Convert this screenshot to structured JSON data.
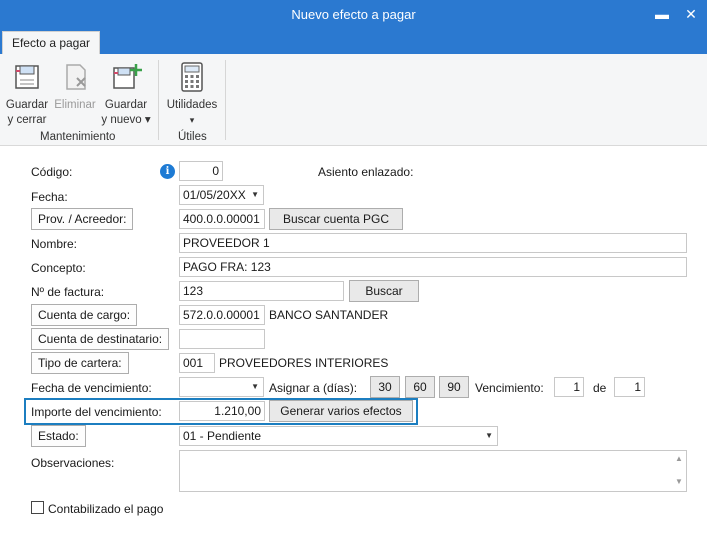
{
  "window": {
    "title": "Nuevo efecto a pagar"
  },
  "tabs": [
    {
      "label": "Efecto a pagar"
    }
  ],
  "ribbon": {
    "guardar_cerrar": {
      "line1": "Guardar",
      "line2": "y cerrar"
    },
    "eliminar": {
      "label": "Eliminar"
    },
    "guardar_nuevo": {
      "line1": "Guardar",
      "line2": "y nuevo ▾"
    },
    "utilidades": {
      "label": "Utilidades",
      "arrow": "▾"
    },
    "group_mantenimiento": "Mantenimiento",
    "group_utiles": "Útiles"
  },
  "form": {
    "codigo": {
      "label": "Código:",
      "value": "0"
    },
    "asiento": {
      "label": "Asiento enlazado:"
    },
    "fecha": {
      "label": "Fecha:",
      "value": "01/05/20XX"
    },
    "prov": {
      "label": "Prov. / Acreedor:",
      "value": "400.0.0.00001",
      "button": "Buscar cuenta PGC"
    },
    "nombre": {
      "label": "Nombre:",
      "value": "PROVEEDOR 1"
    },
    "concepto": {
      "label": "Concepto:",
      "value": "PAGO FRA: 123"
    },
    "factura": {
      "label": "Nº de factura:",
      "value": "123",
      "button": "Buscar"
    },
    "cuenta_cargo": {
      "label": "Cuenta de cargo:",
      "value": "572.0.0.00001",
      "desc": "BANCO SANTANDER"
    },
    "cuenta_destinatario": {
      "label": "Cuenta de destinatario:",
      "value": ""
    },
    "tipo_cartera": {
      "label": "Tipo de cartera:",
      "value": "001",
      "desc": "PROVEEDORES INTERIORES"
    },
    "fecha_venc": {
      "label": "Fecha de vencimiento:",
      "value": ""
    },
    "asignar": {
      "label": "Asignar a (días):",
      "d1": "30",
      "d2": "60",
      "d3": "90"
    },
    "vencimiento": {
      "label": "Vencimiento:",
      "value": "1",
      "de": "de",
      "total": "1"
    },
    "importe": {
      "label": "Importe del vencimiento:",
      "value": "1.210,00",
      "button": "Generar varios efectos"
    },
    "estado": {
      "label": "Estado:",
      "value": "01 - Pendiente"
    },
    "observaciones": {
      "label": "Observaciones:"
    },
    "contabilizado": {
      "label": "Contabilizado el pago"
    }
  },
  "colors": {
    "titlebar": "#2b79d0",
    "highlight": "#1c7ec0",
    "info": "#1e7bd4"
  },
  "icons": [
    "minimize-icon",
    "close-icon",
    "save-close-icon",
    "delete-icon",
    "save-new-icon",
    "calculator-icon",
    "info-icon",
    "chevron-down-icon"
  ]
}
